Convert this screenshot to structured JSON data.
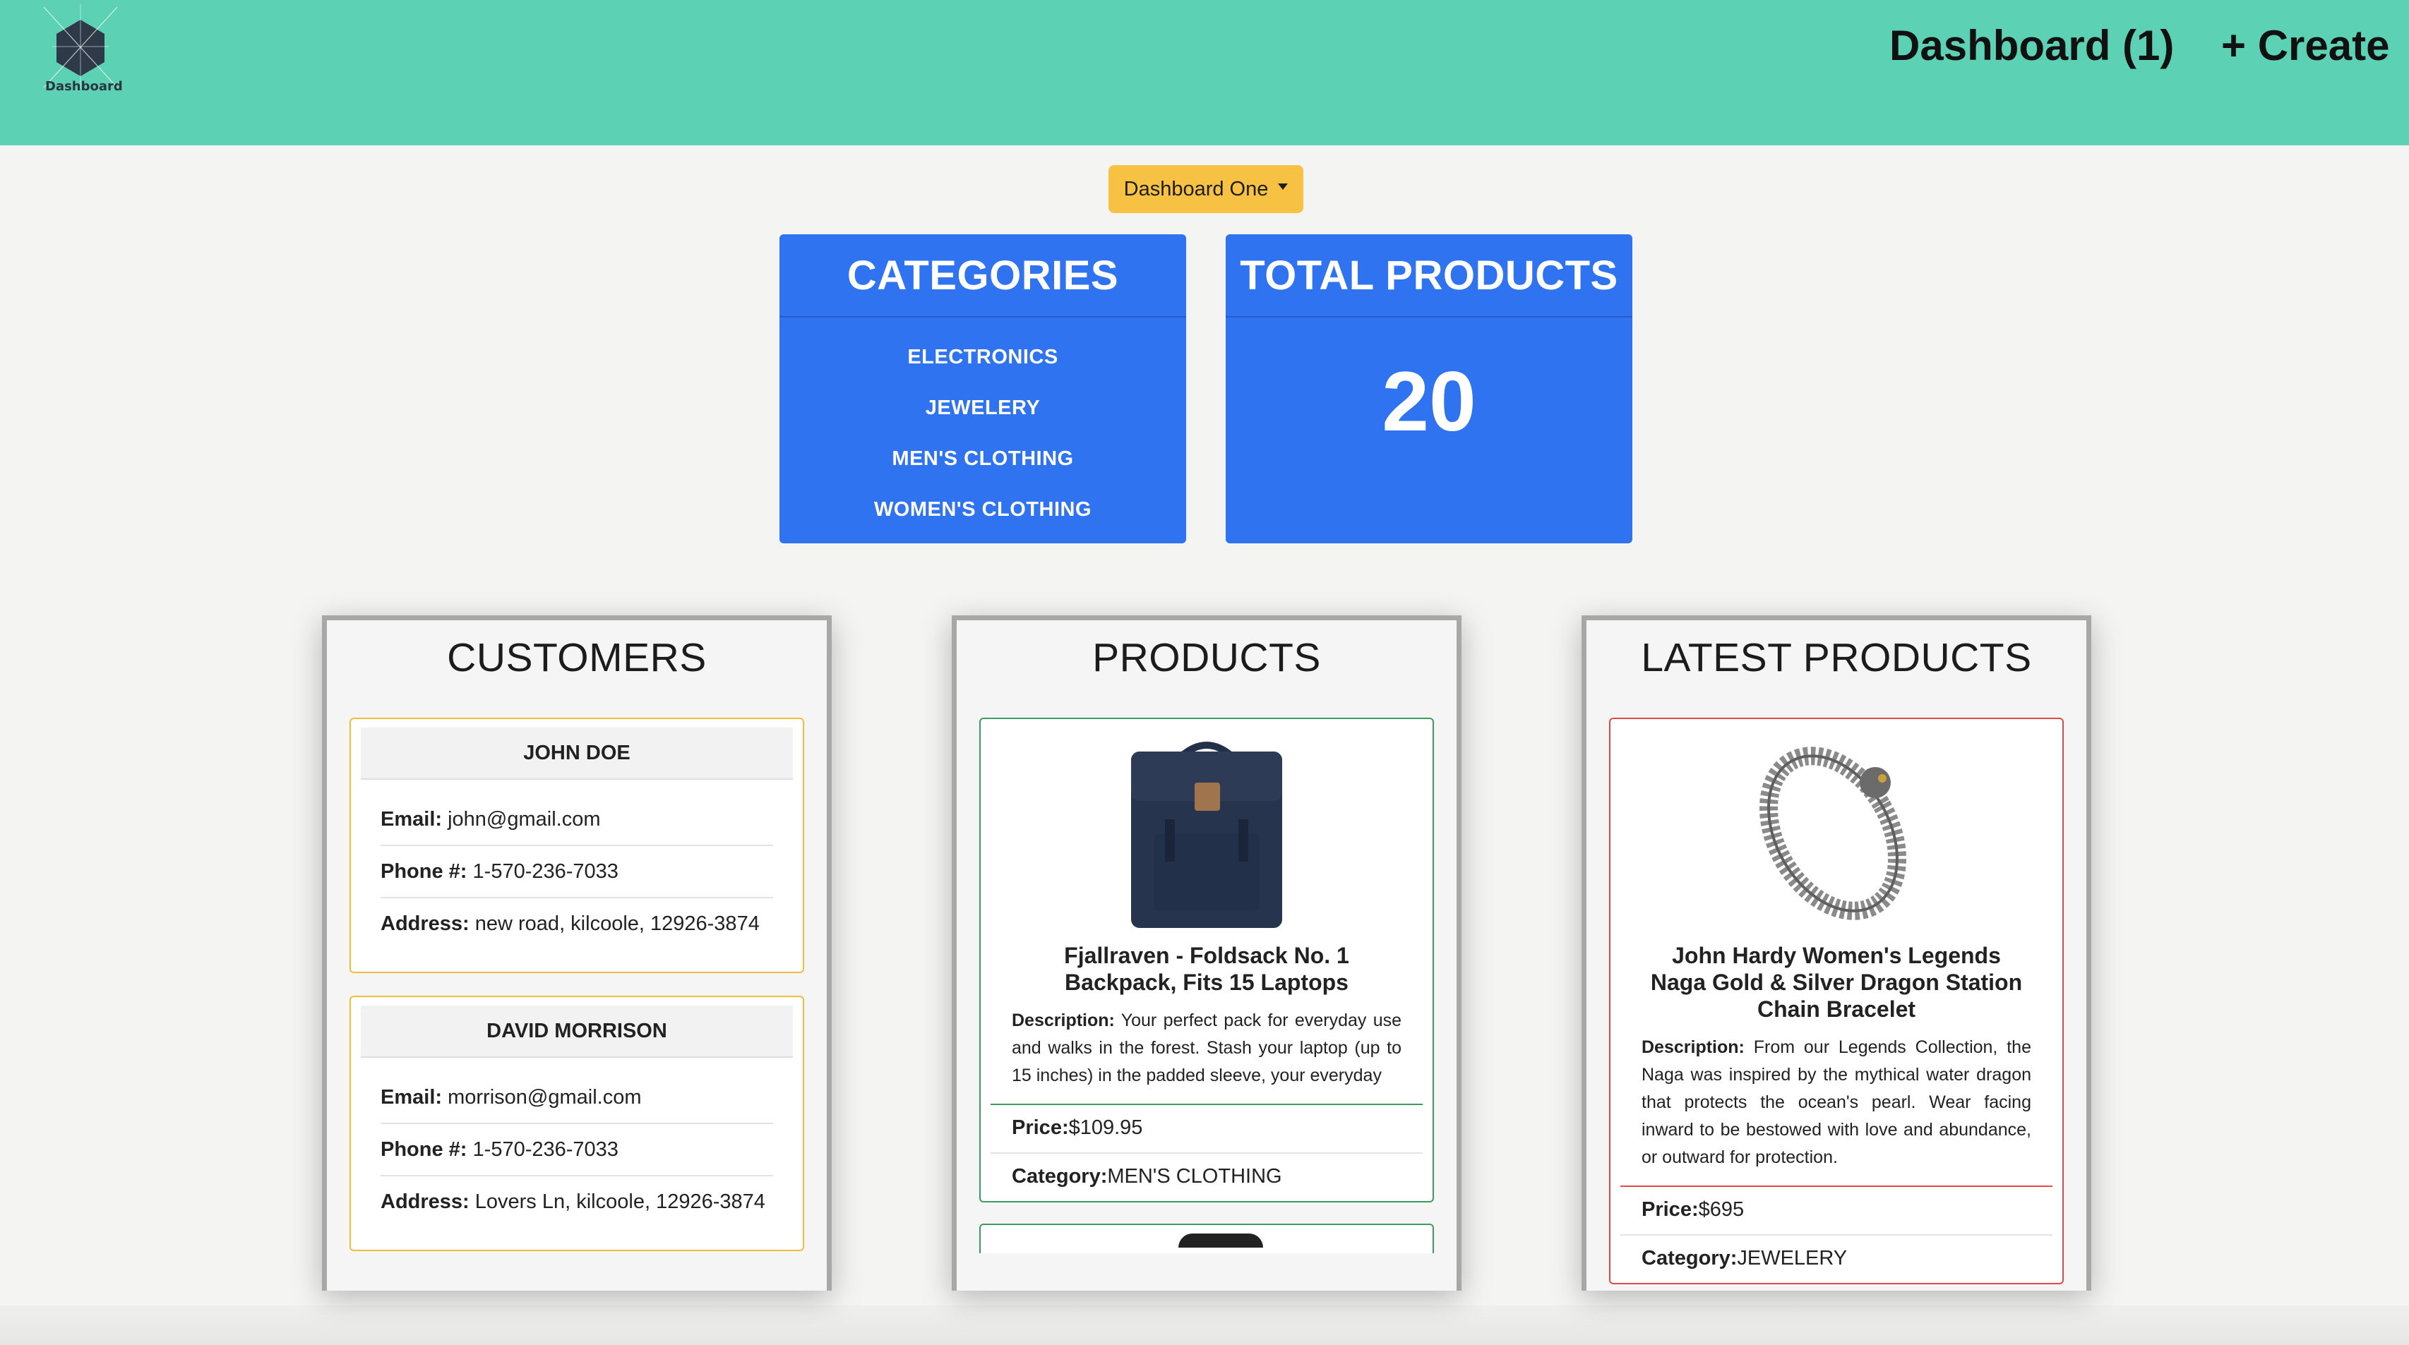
{
  "header": {
    "logo_text": "Dashboard",
    "nav_dashboard": "Dashboard (1)",
    "nav_create": "+ Create"
  },
  "dropdown": {
    "label": "Dashboard One"
  },
  "categories_card": {
    "title": "CATEGORIES",
    "items": [
      "ELECTRONICS",
      "JEWELERY",
      "MEN'S CLOTHING",
      "WOMEN'S CLOTHING"
    ]
  },
  "total_products_card": {
    "title": "TOTAL PRODUCTS",
    "value": "20"
  },
  "customers_panel": {
    "title": "CUSTOMERS",
    "customers": [
      {
        "name": "JOHN DOE",
        "email_label": "Email:",
        "email": "john@gmail.com",
        "phone_label": "Phone #:",
        "phone": "1-570-236-7033",
        "address_label": "Address:",
        "address": "new road, kilcoole, 12926-3874"
      },
      {
        "name": "DAVID MORRISON",
        "email_label": "Email:",
        "email": "morrison@gmail.com",
        "phone_label": "Phone #:",
        "phone": "1-570-236-7033",
        "address_label": "Address:",
        "address": "Lovers Ln, kilcoole, 12926-3874"
      }
    ]
  },
  "products_panel": {
    "title": "PRODUCTS",
    "product": {
      "image_icon": "backpack-image",
      "title": "Fjallraven - Foldsack No. 1 Backpack, Fits 15 Laptops",
      "description_label": "Description:",
      "description": "Your perfect pack for everyday use and walks in the forest. Stash your laptop (up to 15 inches) in the padded sleeve, your everyday",
      "price_label": "Price:",
      "price": "$109.95",
      "category_label": "Category:",
      "category": "MEN'S CLOTHING"
    }
  },
  "latest_panel": {
    "title": "LATEST PRODUCTS",
    "product": {
      "image_icon": "bracelet-image",
      "title": "John Hardy Women's Legends Naga Gold & Silver Dragon Station Chain Bracelet",
      "description_label": "Description:",
      "description": "From our Legends Collection, the Naga was inspired by the mythical water dragon that protects the ocean's pearl. Wear facing inward to be bestowed with love and abundance, or outward for protection.",
      "price_label": "Price:",
      "price": "$695",
      "category_label": "Category:",
      "category": "JEWELERY"
    }
  },
  "colors": {
    "header_bg": "#5dd1b3",
    "stat_card_bg": "#2f73f0",
    "dropdown_bg": "#f7c244",
    "customer_border": "#f3bd3b",
    "product_border": "#3c9a62",
    "latest_border": "#e24a4a"
  }
}
